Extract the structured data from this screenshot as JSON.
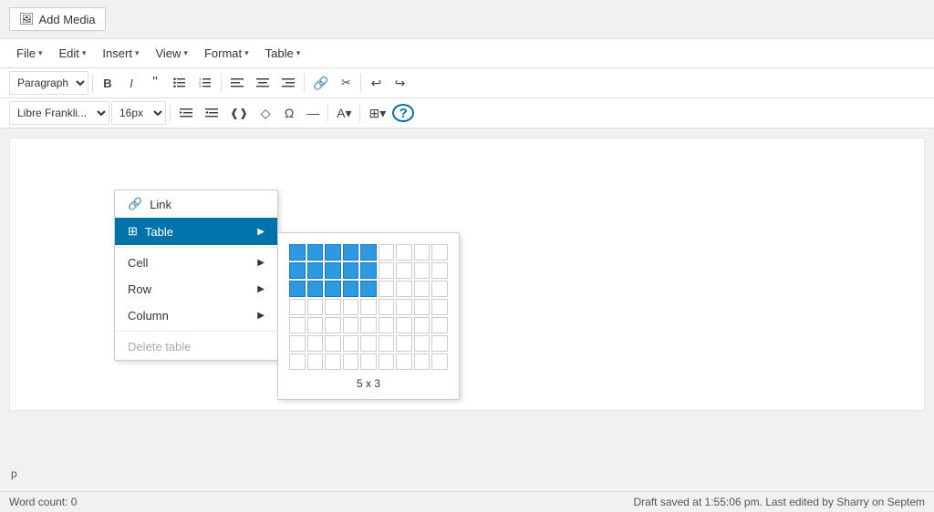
{
  "topbar": {
    "add_media_label": "Add Media"
  },
  "menubar": {
    "items": [
      {
        "label": "File",
        "id": "file"
      },
      {
        "label": "Edit",
        "id": "edit"
      },
      {
        "label": "Insert",
        "id": "insert"
      },
      {
        "label": "View",
        "id": "view"
      },
      {
        "label": "Format",
        "id": "format"
      },
      {
        "label": "Table",
        "id": "table"
      }
    ]
  },
  "toolbar1": {
    "paragraph_select": "Paragraph",
    "buttons": [
      "B",
      "I",
      "❝",
      "≡",
      "≡",
      "≡",
      "≡",
      "≡",
      "🔗",
      "✂",
      "↩",
      "↪"
    ]
  },
  "toolbar2": {
    "font_select": "Libre Frankli...",
    "size_select": "16px"
  },
  "context_menu": {
    "items": [
      {
        "label": "Link",
        "icon": "🔗",
        "has_sub": false,
        "active": false,
        "disabled": false,
        "id": "link"
      },
      {
        "label": "Table",
        "icon": "⊞",
        "has_sub": true,
        "active": true,
        "disabled": false,
        "id": "table"
      },
      {
        "label": "Cell",
        "icon": "",
        "has_sub": true,
        "active": false,
        "disabled": false,
        "id": "cell"
      },
      {
        "label": "Row",
        "icon": "",
        "has_sub": true,
        "active": false,
        "disabled": false,
        "id": "row"
      },
      {
        "label": "Column",
        "icon": "",
        "has_sub": true,
        "active": false,
        "disabled": false,
        "id": "column"
      },
      {
        "label": "Delete table",
        "icon": "",
        "has_sub": false,
        "active": false,
        "disabled": true,
        "id": "delete-table"
      }
    ]
  },
  "grid": {
    "rows": 7,
    "cols": 9,
    "highlighted_rows": 3,
    "highlighted_cols": 5,
    "label": "5 x 3"
  },
  "statusbar": {
    "p_indicator": "p",
    "word_count_label": "Word count: 0",
    "draft_info": "Draft saved at 1:55:06 pm. Last edited by Sharry on Septem"
  }
}
